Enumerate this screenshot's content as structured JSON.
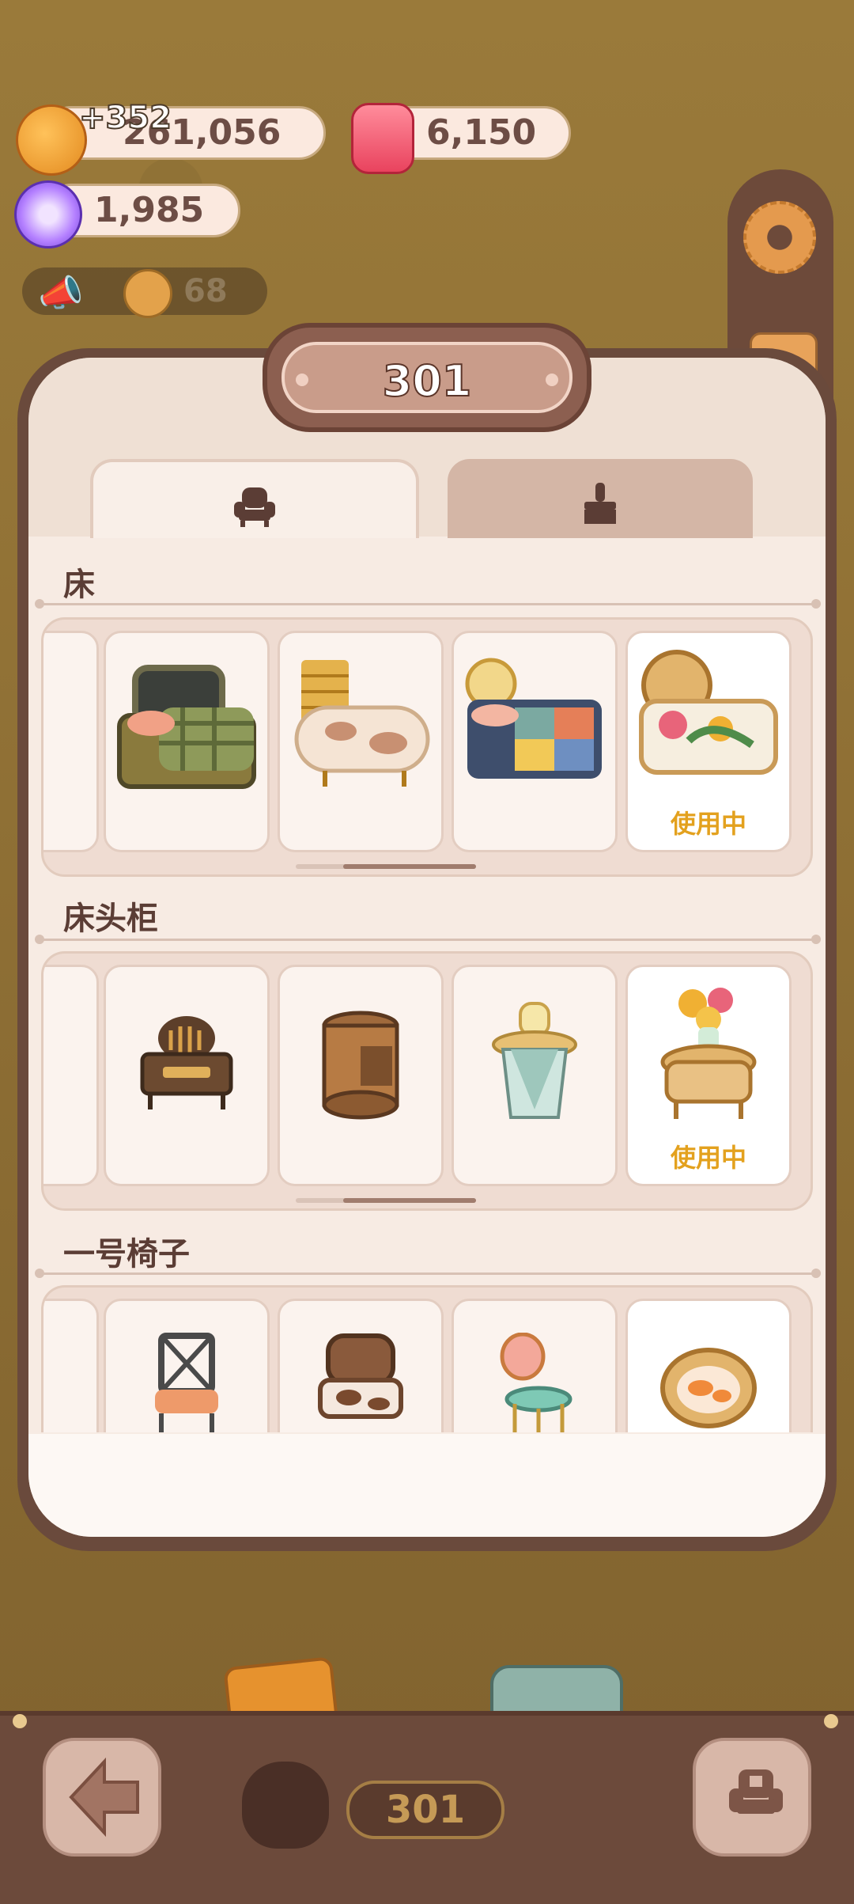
{
  "currencies": {
    "cookies": {
      "value": "261,056",
      "floating_bonus": "+352"
    },
    "gems": {
      "value": "6,150"
    },
    "candy": {
      "value": "1,985"
    }
  },
  "news_bar": {
    "count": "68"
  },
  "room": {
    "number": "301"
  },
  "tabs": [
    {
      "name": "furniture",
      "icon": "armchair-icon",
      "selected": true
    },
    {
      "name": "decor",
      "icon": "brush-icon",
      "selected": false
    }
  ],
  "sections": [
    {
      "title": "床",
      "items": [
        {
          "name": "green-plaid-bed",
          "status": ""
        },
        {
          "name": "cow-print-bed",
          "status": ""
        },
        {
          "name": "patchwork-bed",
          "status": ""
        },
        {
          "name": "rattan-floral-bed",
          "status": "使用中"
        }
      ]
    },
    {
      "title": "床头柜",
      "items": [
        {
          "name": "bread-nightstand",
          "status": ""
        },
        {
          "name": "barrel-nightstand",
          "status": ""
        },
        {
          "name": "lamp-side-table",
          "status": ""
        },
        {
          "name": "rattan-flower-table",
          "status": "使用中"
        }
      ]
    },
    {
      "title": "一号椅子",
      "items": [
        {
          "name": "dark-cross-back-chair",
          "status": ""
        },
        {
          "name": "cow-print-chair",
          "status": ""
        },
        {
          "name": "mint-stool",
          "status": ""
        },
        {
          "name": "rattan-orange-chair",
          "status": ""
        }
      ]
    }
  ],
  "bottom_bar": {
    "room_tag": "301"
  },
  "colors": {
    "accent_status": "#e3a11e",
    "panel": "#f7ebe3",
    "frame": "#6a4a3c"
  }
}
